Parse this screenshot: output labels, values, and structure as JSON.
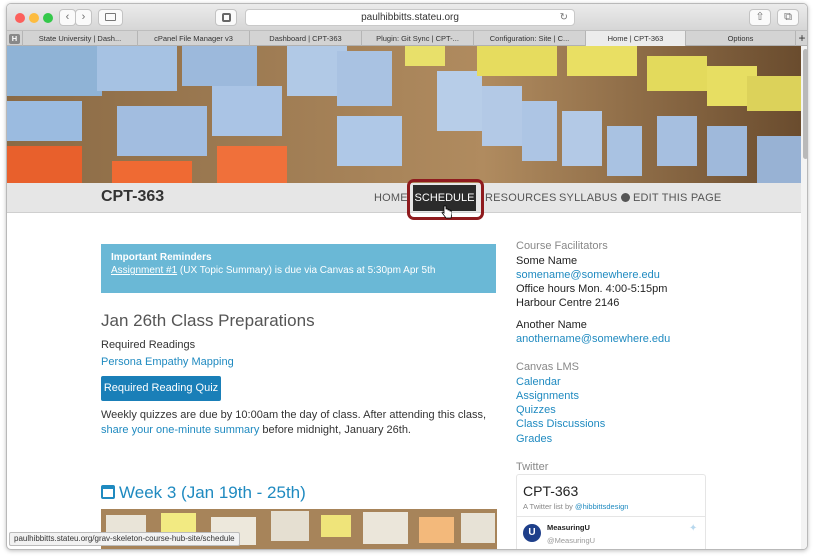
{
  "browser": {
    "url": "paulhibbitts.stateu.org",
    "tabs": [
      "State University | Dash...",
      "cPanel File Manager v3",
      "Dashboard | CPT-363",
      "Plugin: Git Sync | CPT-...",
      "Configuration: Site | C...",
      "Home | CPT-363",
      "Options"
    ],
    "active_tab": 5,
    "status_url": "paulhibbitts.stateu.org/grav-skeleton-course-hub-site/schedule"
  },
  "site": {
    "brand": "CPT-363",
    "nav": {
      "home": "HOME",
      "schedule": "SCHEDULE",
      "resources": "RESOURCES",
      "syllabus": "SYLLABUS",
      "edit": "EDIT THIS PAGE"
    }
  },
  "reminder": {
    "title": "Important Reminders",
    "link": "Assignment #1",
    "text": " (UX Topic Summary) is due via Canvas at 5:30pm Apr 5th"
  },
  "main": {
    "heading": "Jan 26th Class Preparations",
    "readings_label": "Required Readings",
    "reading_link": "Persona Empathy Mapping",
    "quiz_button": "Required Reading Quiz",
    "weekly_text": "Weekly quizzes are due by 10:00am the day of class. After attending this class,",
    "summary_link": "share your one-minute summary",
    "summary_tail": " before midnight, January 26th.",
    "week_heading": "Week 3 (Jan 19th - 25th)"
  },
  "sidebar": {
    "facilitators_heading": "Course Facilitators",
    "facilitator1": "Some Name",
    "email1": "somename@somewhere.edu",
    "hours": "Office hours Mon. 4:00-5:15pm",
    "office": "Harbour Centre 2146",
    "facilitator2": "Another Name",
    "email2": "anothername@somewhere.edu",
    "lms_heading": "Canvas LMS",
    "lms_links": [
      "Calendar",
      "Assignments",
      "Quizzes",
      "Class Discussions",
      "Grades"
    ],
    "twitter_heading": "Twitter",
    "twitter_title": "CPT-363",
    "twitter_by": "A Twitter list by ",
    "twitter_handle": "@hibbittsdesign",
    "tweet_name": "MeasuringU",
    "tweet_handle": "@MeasuringU"
  },
  "colors": {
    "accent": "#1f8ac0",
    "highlight": "#8f1b1e",
    "reminder": "#6ab8d6"
  }
}
